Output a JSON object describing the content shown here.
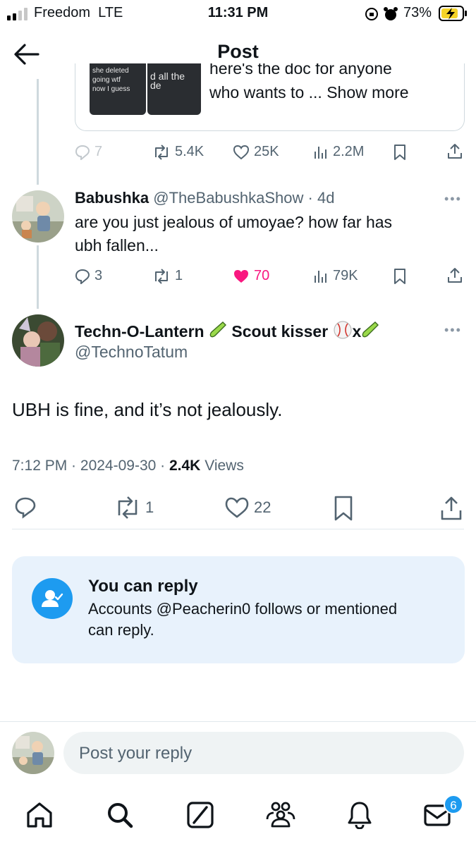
{
  "status_bar": {
    "carrier": "Freedom",
    "network": "LTE",
    "time": "11:31 PM",
    "battery_percent": "73%"
  },
  "header": {
    "title": "Post",
    "back_icon": "arrow-left-icon"
  },
  "quoted_preview": {
    "thumb1_lines": [
      "she deleted",
      "going wtf",
      "now I guess"
    ],
    "thumb2_text": "d all the de",
    "text_line1": "here's the doc for anyone",
    "text_line2": "who wants to ...",
    "show_more": "Show more"
  },
  "parent_actions": {
    "replies": "7",
    "reposts": "5.4K",
    "likes": "25K",
    "views": "2.2M"
  },
  "reply_tweet": {
    "name": "Babushka",
    "handle": "@TheBabushkaShow",
    "age": "4d",
    "text_line1": "are you just jealous of umoyae? how far has",
    "text_line2": "ubh fallen...",
    "replies": "3",
    "reposts": "1",
    "likes": "70",
    "views": "79K"
  },
  "main_tweet": {
    "name": "Techn-O-Lantern",
    "name_extra": "Scout kisser",
    "name_suffix": "x",
    "handle": "@TechnoTatum",
    "text": "UBH is fine, and it’s not jealously.",
    "time": "7:12 PM",
    "date": "2024-09-30",
    "views_count": "2.4K",
    "views_label": "Views",
    "reposts": "1",
    "likes": "22"
  },
  "reply_restriction": {
    "title": "You can reply",
    "line1": "Accounts @Peacherin0 follows or mentioned",
    "line2": "can reply."
  },
  "composer": {
    "placeholder": "Post your reply"
  },
  "tab_bar": {
    "items": [
      "home-icon",
      "search-icon",
      "grok-icon",
      "communities-icon",
      "notifications-icon",
      "messages-icon"
    ],
    "messages_badge": "6"
  },
  "colors": {
    "accent": "#1d9bf0",
    "like_pink": "#f91880",
    "text_dim": "#536471",
    "card_bg": "#e8f2fc"
  }
}
